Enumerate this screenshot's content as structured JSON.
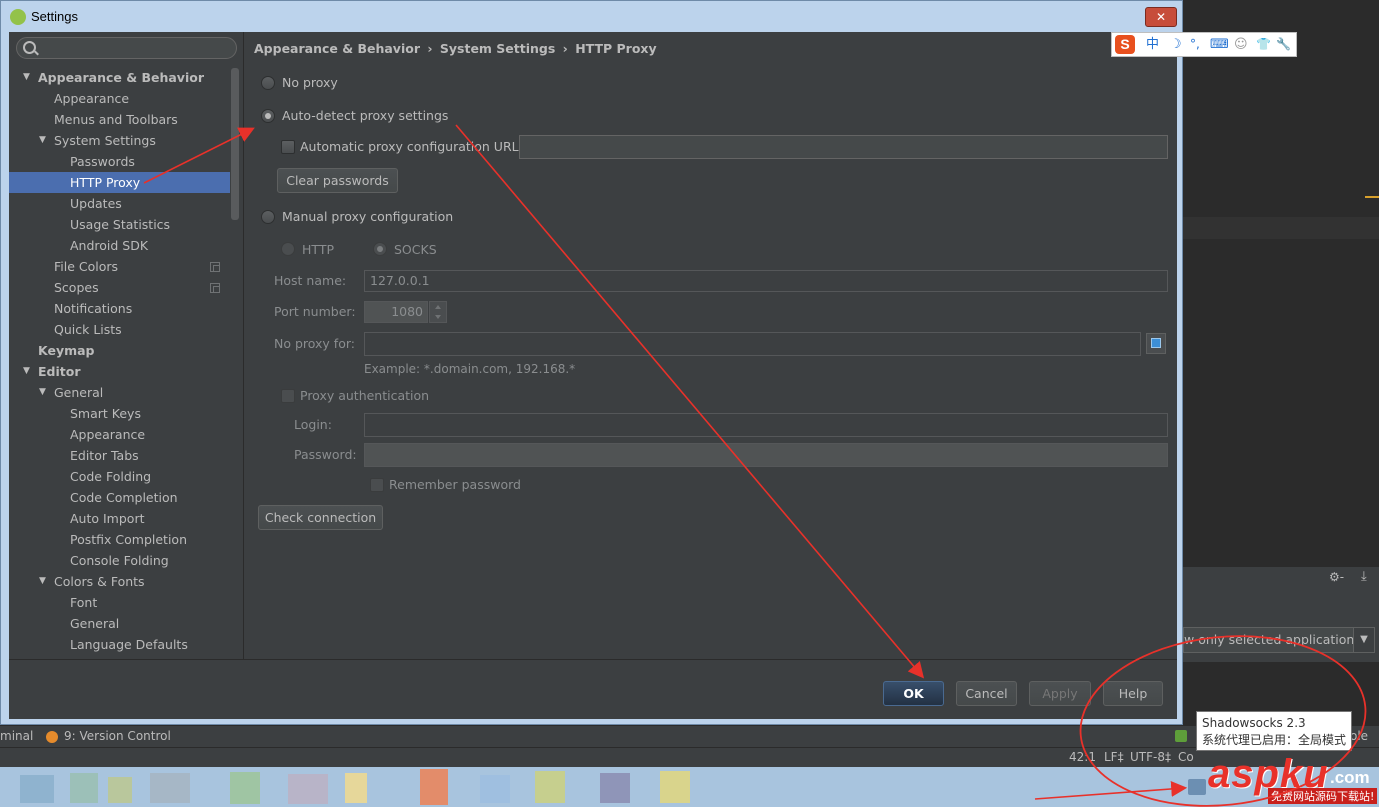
{
  "window": {
    "title": "Settings",
    "close_glyph": "✕"
  },
  "breadcrumb": [
    "Appearance & Behavior",
    "System Settings",
    "HTTP Proxy"
  ],
  "breadcrumb_sep": "›",
  "sidebar": {
    "items": [
      {
        "label": "Appearance & Behavior",
        "level": 0,
        "bold": true,
        "expanded": true
      },
      {
        "label": "Appearance",
        "level": 1
      },
      {
        "label": "Menus and Toolbars",
        "level": 1
      },
      {
        "label": "System Settings",
        "level": 1,
        "expanded": true
      },
      {
        "label": "Passwords",
        "level": 2
      },
      {
        "label": "HTTP Proxy",
        "level": 2,
        "selected": true
      },
      {
        "label": "Updates",
        "level": 2
      },
      {
        "label": "Usage Statistics",
        "level": 2
      },
      {
        "label": "Android SDK",
        "level": 2
      },
      {
        "label": "File Colors",
        "level": 1,
        "copy": true
      },
      {
        "label": "Scopes",
        "level": 1,
        "copy": true
      },
      {
        "label": "Notifications",
        "level": 1
      },
      {
        "label": "Quick Lists",
        "level": 1
      },
      {
        "label": "Keymap",
        "level": 0,
        "bold": true
      },
      {
        "label": "Editor",
        "level": 0,
        "bold": true,
        "expanded": true
      },
      {
        "label": "General",
        "level": 1,
        "expanded": true
      },
      {
        "label": "Smart Keys",
        "level": 2
      },
      {
        "label": "Appearance",
        "level": 2
      },
      {
        "label": "Editor Tabs",
        "level": 2
      },
      {
        "label": "Code Folding",
        "level": 2
      },
      {
        "label": "Code Completion",
        "level": 2
      },
      {
        "label": "Auto Import",
        "level": 2
      },
      {
        "label": "Postfix Completion",
        "level": 2
      },
      {
        "label": "Console Folding",
        "level": 2
      },
      {
        "label": "Colors & Fonts",
        "level": 1,
        "expanded": true
      },
      {
        "label": "Font",
        "level": 2
      },
      {
        "label": "General",
        "level": 2
      },
      {
        "label": "Language Defaults",
        "level": 2
      }
    ]
  },
  "proxy": {
    "no_proxy": "No proxy",
    "auto_detect": "Auto-detect proxy settings",
    "auto_config_url": "Automatic proxy configuration URL:",
    "clear_passwords": "Clear passwords",
    "manual": "Manual proxy configuration",
    "http": "HTTP",
    "socks": "SOCKS",
    "host_label": "Host name:",
    "host_value": "127.0.0.1",
    "port_label": "Port number:",
    "port_value": "1080",
    "no_proxy_for_label": "No proxy for:",
    "example": "Example: *.domain.com, 192.168.*",
    "proxy_auth": "Proxy authentication",
    "login_label": "Login:",
    "password_label": "Password:",
    "remember_password": "Remember password",
    "check_connection": "Check connection"
  },
  "footer": {
    "ok": "OK",
    "cancel": "Cancel",
    "apply": "Apply",
    "help": "Help"
  },
  "ime": {
    "logo": "S",
    "glyphs": [
      "中",
      "☽",
      "°,",
      "⌨",
      "☺",
      "👕",
      "🔧"
    ]
  },
  "ide": {
    "toolwin_terminal": "minal",
    "toolwin_vcs": "9: Version Control",
    "status_pos": "42:1",
    "status_lf": "LF‡",
    "status_enc": "UTF-8‡",
    "status_co": "Co",
    "status_le": "ole",
    "select_text": "w only selected application",
    "select_arrow": "▼",
    "gear": "⚙-",
    "download": "⤓"
  },
  "tooltip": {
    "line1": "Shadowsocks 2.3",
    "line2": "系统代理已启用：全局模式"
  },
  "watermark": {
    "main": "aspku",
    "com": ".com",
    "sub": "免费网站源码下载站!"
  },
  "colors": {
    "selection": "#4b6eaf",
    "annotation": "#e8312a",
    "panel": "#3c3f41"
  }
}
